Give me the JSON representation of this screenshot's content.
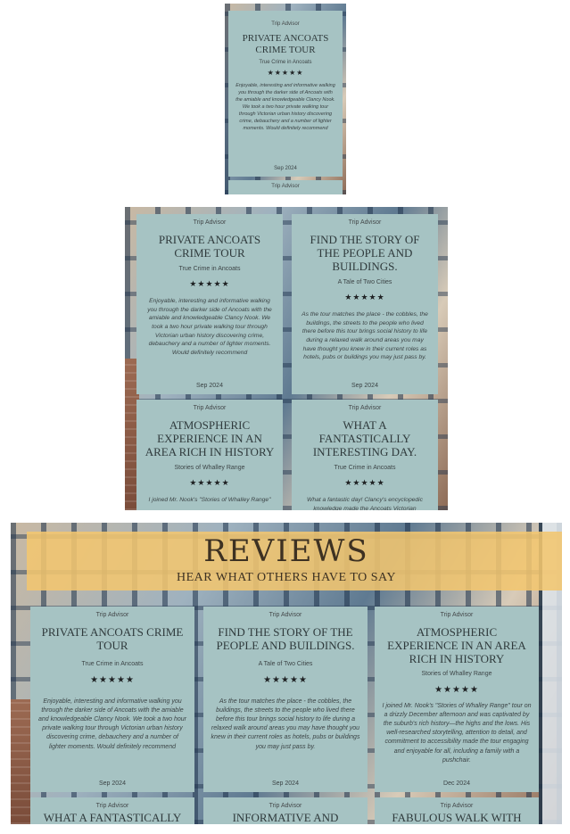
{
  "small_view": {
    "review": {
      "source": "Trip Advisor",
      "title": "Private Ancoats Crime Tour",
      "tour": "True Crime in Ancoats",
      "stars": "★★★★★",
      "text": "Enjoyable, interesting and informative walking you through the darker side of Ancoats with the amiable and knowledgeable Clancy Nook. We took a two hour private walking tour through Victorian urban history discovering crime, debauchery and a number of lighter moments. Would definitely recommend",
      "date": "Sep 2024"
    },
    "next_source": "Trip Advisor"
  },
  "medium_view": {
    "reviews": [
      {
        "source": "Trip Advisor",
        "title": "Private Ancoats Crime Tour",
        "tour": "True Crime in Ancoats",
        "stars": "★★★★★",
        "text": "Enjoyable, interesting and informative walking you through the darker side of Ancoats with the amiable and knowledgeable Clancy Nook. We took a two hour private walking tour through Victorian urban history discovering crime, debauchery and a number of lighter moments. Would definitely recommend",
        "date": "Sep 2024"
      },
      {
        "source": "Trip Advisor",
        "title": "Find the story of the people and buildings.",
        "tour": "A Tale of Two Cities",
        "stars": "★★★★★",
        "text": "As the tour matches the place - the cobbles, the buildings, the streets to the people who lived there before this tour brings social history to life during a relaxed walk around areas you may have thought you knew in their current roles as hotels, pubs or buildings you may just pass by.",
        "date": "Sep 2024"
      },
      {
        "source": "Trip Advisor",
        "title": "Atmospheric experience in an area rich in history",
        "tour": "Stories of Whalley Range",
        "stars": "★★★★★",
        "text": "I joined Mr. Nook's \"Stories of Whalley Range\"",
        "date": ""
      },
      {
        "source": "Trip Advisor",
        "title": "What a fantastically interesting day.",
        "tour": "True Crime in Ancoats",
        "stars": "★★★★★",
        "text": "What a fantastic day! Clancy's encyclopedic knowledge made the Ancoats Victorian",
        "date": ""
      }
    ]
  },
  "large_view": {
    "heading": "REVIEWS",
    "subheading": "HEAR WHAT OTHERS HAVE TO SAY",
    "reviews": [
      {
        "source": "Trip Advisor",
        "title": "Private Ancoats Crime Tour",
        "tour": "True Crime in Ancoats",
        "stars": "★★★★★",
        "text": "Enjoyable, interesting and informative walking you through the darker side of Ancoats with the amiable and knowledgeable Clancy Nook. We took a two hour private walking tour through Victorian urban history discovering crime, debauchery and a number of lighter moments. Would definitely recommend",
        "date": "Sep 2024"
      },
      {
        "source": "Trip Advisor",
        "title": "Find the story of the people and buildings.",
        "tour": "A Tale of Two Cities",
        "stars": "★★★★★",
        "text": "As the tour matches the place - the cobbles, the buildings, the streets to the people who lived there before this tour brings social history to life during a relaxed walk around areas you may have thought you knew in their current roles as hotels, pubs or buildings you may just pass by.",
        "date": "Sep 2024"
      },
      {
        "source": "Trip Advisor",
        "title": "Atmospheric experience in an area rich in history",
        "tour": "Stories of Whalley Range",
        "stars": "★★★★★",
        "text": "I joined Mr. Nook's \"Stories of Whalley Range\" tour on a drizzly December afternoon and was captivated by the suburb's rich history—the highs and the lows. His well-researched storytelling, attention to detail, and commitment to accessibility made the tour engaging and enjoyable for all, including a family with a pushchair.",
        "date": "Dec 2024"
      },
      {
        "source": "Trip Advisor",
        "title": "What a fantastically",
        "tour": "",
        "stars": "",
        "text": "",
        "date": ""
      },
      {
        "source": "Trip Advisor",
        "title": "Informative and",
        "tour": "",
        "stars": "",
        "text": "",
        "date": ""
      },
      {
        "source": "Trip Advisor",
        "title": "Fabulous walk with",
        "tour": "",
        "stars": "",
        "text": "",
        "date": ""
      }
    ]
  }
}
